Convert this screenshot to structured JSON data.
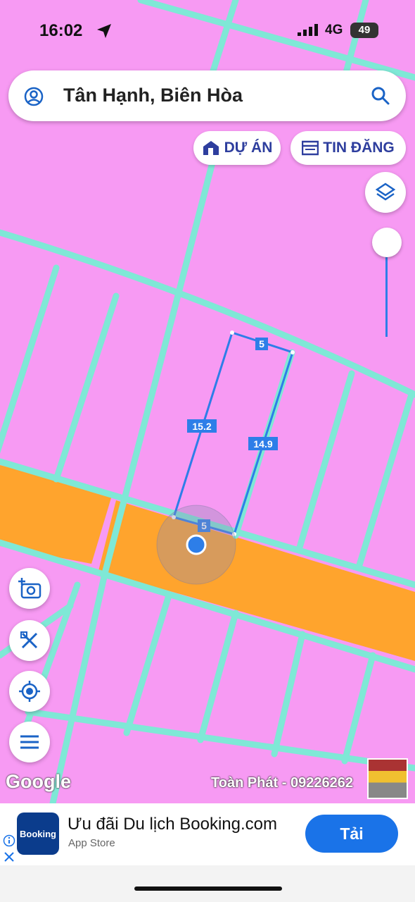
{
  "status_bar": {
    "time": "16:02",
    "network": "4G",
    "battery": "49"
  },
  "search": {
    "query": "Tân Hạnh, Biên Hòa",
    "user_icon": "user-circle-icon",
    "search_icon": "search-icon"
  },
  "chips": {
    "projects": "DỰ ÁN",
    "listings": "TIN ĐĂNG"
  },
  "map": {
    "plot_labels": {
      "top": "5",
      "left": "15.2",
      "right": "14.9",
      "bottom": "5"
    },
    "google_label": "Google",
    "watermark": "Toàn Phát - 09226262",
    "colors": {
      "land": "#f79af3",
      "parcel_line": "#7fe8d6",
      "road": "#ffa42d",
      "plot_outline": "#2d7ee8",
      "location_dot": "#2d7ee8"
    }
  },
  "tools": {
    "layers": "layers-icon",
    "add_photo": "add-photo-icon",
    "measure": "measure-icon",
    "locate": "my-location-icon",
    "menu": "menu-icon"
  },
  "ad": {
    "logo_text": "Booking",
    "title": "Ưu đãi Du lịch Booking.com",
    "subtitle": "App Store",
    "button": "Tải"
  }
}
